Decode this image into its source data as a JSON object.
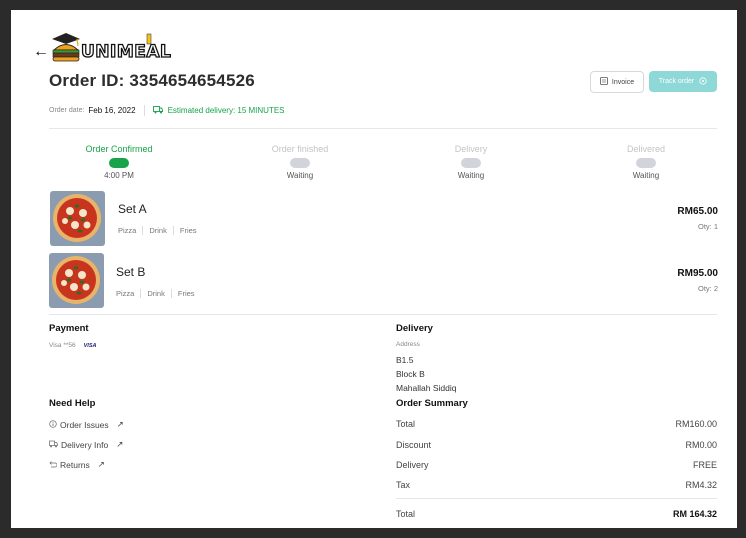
{
  "app": {
    "brand": "UNIMEAL"
  },
  "header": {
    "back_icon": "arrow-left-icon",
    "title": "Order ID: 3354654654526",
    "invoice_label": "Invoice",
    "track_label": "Track order",
    "order_date_label": "Order date:",
    "order_date": "Feb 16, 2022",
    "eta": "Estimated delivery: 15 MINUTES"
  },
  "progress": [
    {
      "label": "Order Confirmed",
      "sub": "4:00 PM",
      "active": true
    },
    {
      "label": "Order finished",
      "sub": "Waiting",
      "active": false
    },
    {
      "label": "Delivery",
      "sub": "Waiting",
      "active": false
    },
    {
      "label": "Delivered",
      "sub": "Waiting",
      "active": false
    }
  ],
  "items": [
    {
      "name": "Set A",
      "tags": [
        "Pizza",
        "Drink",
        "Fries"
      ],
      "price": "RM65.00",
      "qty": "Oty: 1"
    },
    {
      "name": "Set B",
      "tags": [
        "Pizza",
        "Drink",
        "Fries"
      ],
      "price": "RM95.00",
      "qty": "Oty: 2"
    }
  ],
  "payment": {
    "title": "Payment",
    "card": "Visa **56",
    "card_brand": "VISA"
  },
  "delivery": {
    "title": "Delivery",
    "address_label": "Address",
    "address_lines": [
      "B1.5",
      "Block B",
      "Mahallah Siddiq"
    ]
  },
  "help": {
    "title": "Need Help",
    "links": [
      {
        "label": "Order Issues",
        "icon": "info-icon"
      },
      {
        "label": "Delivery Info",
        "icon": "truck-icon"
      },
      {
        "label": "Returns",
        "icon": "return-icon"
      }
    ]
  },
  "summary": {
    "title": "Order Summary",
    "rows": [
      {
        "label": "Total",
        "value": "RM160.00"
      },
      {
        "label": "Discount",
        "value": "RM0.00"
      },
      {
        "label": "Delivery",
        "value": "FREE"
      },
      {
        "label": "Tax",
        "value": "RM4.32"
      }
    ],
    "grand_label": "Total",
    "grand_value": "RM 164.32"
  },
  "colors": {
    "accent_green": "#16a34a",
    "track_button": "#8ed8d8"
  }
}
